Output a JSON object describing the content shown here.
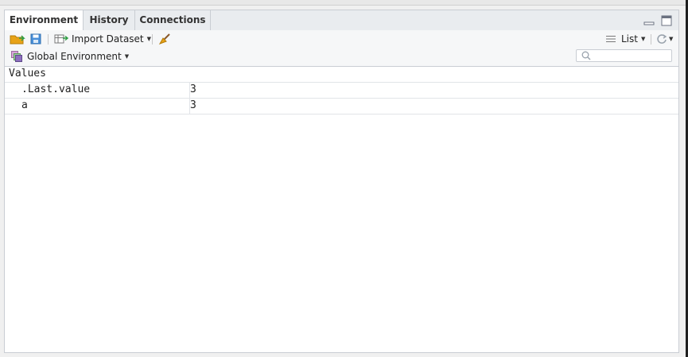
{
  "tabs": [
    {
      "label": "Environment",
      "active": true
    },
    {
      "label": "History",
      "active": false
    },
    {
      "label": "Connections",
      "active": false
    }
  ],
  "toolbar": {
    "open_icon": "folder-open-icon",
    "save_icon": "save-icon",
    "import_label": "Import Dataset",
    "broom_icon": "broom-icon",
    "view_mode": "List",
    "refresh_icon": "refresh-icon"
  },
  "environment_selector": {
    "label": "Global Environment"
  },
  "search": {
    "placeholder": ""
  },
  "values_section": {
    "title": "Values",
    "rows": [
      {
        "name": ".Last.value",
        "value": "3"
      },
      {
        "name": "a",
        "value": "3"
      }
    ]
  },
  "colors": {
    "accent": "#4a90d9",
    "folder": "#e8a317",
    "env_icon": "#8e6fbf"
  }
}
